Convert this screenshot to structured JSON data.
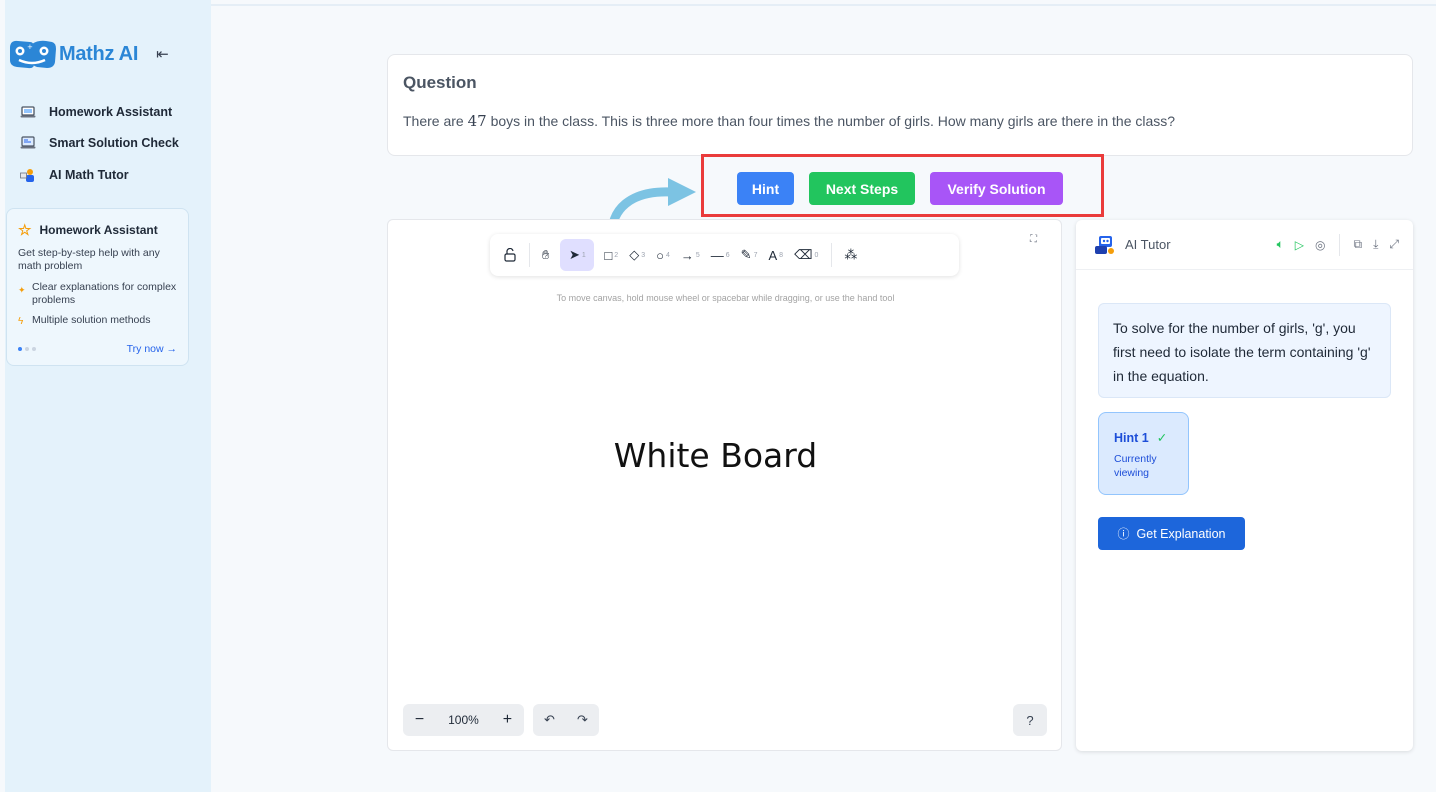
{
  "sidebar": {
    "brand": "Mathz AI",
    "items": [
      {
        "label": "Homework Assistant",
        "icon": "laptop-icon"
      },
      {
        "label": "Smart Solution Check",
        "icon": "monitor-icon"
      },
      {
        "label": "AI Math Tutor",
        "icon": "teacher-icon"
      }
    ],
    "promo": {
      "title": "Homework Assistant",
      "description": "Get step-by-step help with any math problem",
      "bullets": [
        "Clear explanations for complex problems",
        "Multiple solution methods"
      ],
      "cta": "Try now →",
      "active_slide": 1,
      "slide_count": 3
    }
  },
  "question": {
    "heading": "Question",
    "text_before": "There are ",
    "number": "47",
    "text_after": " boys in the class. This is three more than four times the number of girls. How many girls are there in the class?"
  },
  "actions": {
    "hint": "Hint",
    "next_steps": "Next Steps",
    "verify": "Verify Solution"
  },
  "whiteboard": {
    "tools": [
      {
        "name": "lock",
        "key": ""
      },
      {
        "name": "hand",
        "key": ""
      },
      {
        "name": "select",
        "key": "1"
      },
      {
        "name": "rectangle",
        "key": "2"
      },
      {
        "name": "diamond",
        "key": "3"
      },
      {
        "name": "ellipse",
        "key": "4"
      },
      {
        "name": "arrow",
        "key": "5"
      },
      {
        "name": "line",
        "key": "6"
      },
      {
        "name": "draw",
        "key": "7"
      },
      {
        "name": "text",
        "key": "8"
      },
      {
        "name": "eraser",
        "key": "0"
      }
    ],
    "hint": "To move canvas, hold mouse wheel or spacebar while dragging, or use the hand tool",
    "label": "White Board",
    "zoom": "100%"
  },
  "tutor": {
    "title": "AI Tutor",
    "message": "To solve for the number of girls, 'g', you first need to isolate the term containing 'g' in the equation.",
    "hint_label": "Hint 1",
    "hint_status": "Currently viewing",
    "explain_button": "Get Explanation"
  },
  "colors": {
    "brand": "#2b86d6",
    "hint_button": "#3b82f6",
    "next_button": "#22c55e",
    "verify_button": "#a855f7",
    "annotation": "#ea3b3b",
    "annotation_arrow": "#7cc3e3"
  }
}
